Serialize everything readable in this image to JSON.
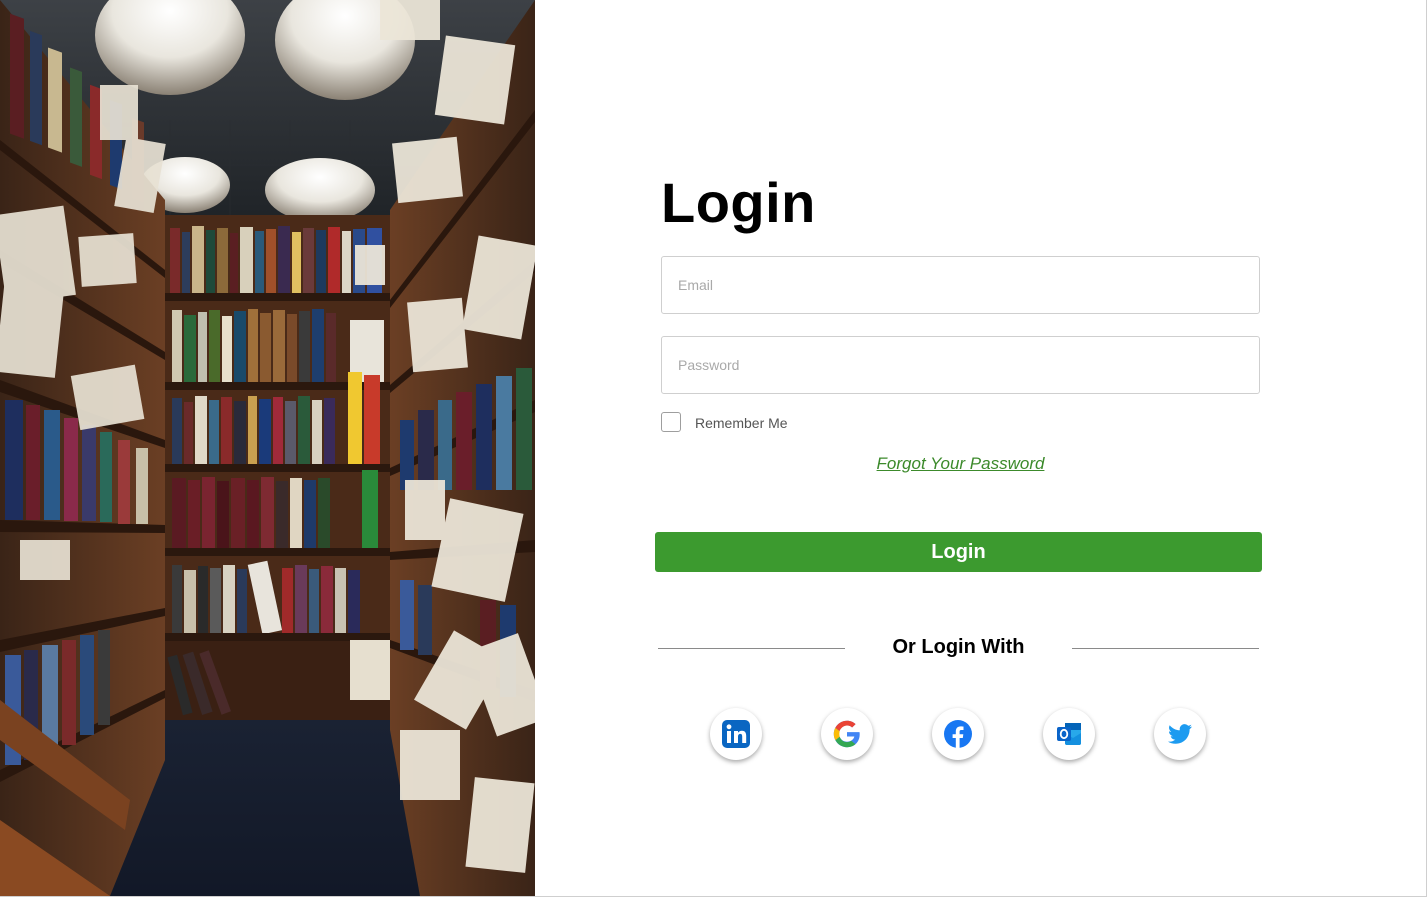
{
  "photo": {
    "alt": "Library aisle with bookshelves and hanging lamps"
  },
  "login": {
    "title": "Login",
    "email_placeholder": "Email",
    "email_value": "",
    "password_placeholder": "Password",
    "password_value": "",
    "remember_label": "Remember Me",
    "remember_checked": false,
    "forgot_label": "Forgot Your Password",
    "submit_label": "Login",
    "divider_text": "Or Login With"
  },
  "social_providers": [
    {
      "name": "LinkedIn",
      "icon": "linkedin-icon",
      "color": "#0a66c2"
    },
    {
      "name": "Google",
      "icon": "google-icon",
      "color": "#4285f4"
    },
    {
      "name": "Facebook",
      "icon": "facebook-icon",
      "color": "#1877f2"
    },
    {
      "name": "Outlook",
      "icon": "outlook-icon",
      "color": "#0a64c9"
    },
    {
      "name": "Twitter",
      "icon": "twitter-icon",
      "color": "#1d9bf0"
    }
  ],
  "colors": {
    "accent_green": "#3c9a2f",
    "link_green": "#3c8a2b",
    "field_border": "#cfcfcf"
  }
}
